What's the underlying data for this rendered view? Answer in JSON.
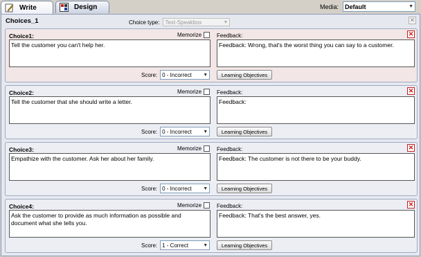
{
  "tabs": {
    "write": "Write",
    "design": "Design"
  },
  "media": {
    "label": "Media:",
    "value": "Default"
  },
  "panel": {
    "title": "Choices_1",
    "choice_type_label": "Choice type:",
    "choice_type_value": "Text-Speakbox",
    "close_symbol": "✕"
  },
  "choice_common": {
    "memorize_label": "Memorize",
    "feedback_label": "Feedback:",
    "score_label": "Score:",
    "learning_objectives": "Learning Objectives",
    "delete_symbol": "✕"
  },
  "choices": [
    {
      "label": "Choice1:",
      "text": "Tell the customer you can't help her.",
      "feedback": "Feedback: Wrong, that's the worst thing you can say to a customer.",
      "score": "0 - Incorrect",
      "memorize": false
    },
    {
      "label": "Choice2:",
      "text": "Tell the customer that she should write a letter.",
      "feedback": "Feedback:",
      "score": "0 - Incorrect",
      "memorize": false
    },
    {
      "label": "Choice3:",
      "text": "Empathize with the customer. Ask her about her family.",
      "feedback": "Feedback: The customer is not there to be your buddy.",
      "score": "0 - Incorrect",
      "memorize": false
    },
    {
      "label": "Choice4:",
      "text": "Ask the customer to provide as much information as possible and document what she tells you.",
      "feedback": "Feedback: That's the best answer, yes.",
      "score": "1 - Correct",
      "memorize": false
    }
  ],
  "colors": {
    "delete_red": "#d01010",
    "selected_choice_bg": "#f2e6e6"
  }
}
